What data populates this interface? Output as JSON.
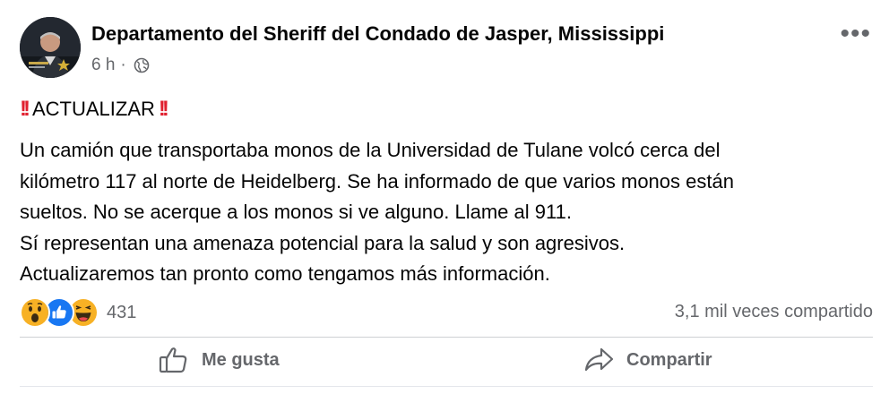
{
  "post": {
    "author": "Departamento del Sheriff del Condado de Jasper, Mississippi",
    "time": "6 h",
    "separator": "·",
    "more_label": "•••",
    "headline": "ACTUALIZAR",
    "body_lines": [
      "Un camión que transportaba monos de la Universidad de Tulane volcó cerca del",
      "kilómetro 117 al norte de Heidelberg. Se ha informado de que varios monos están",
      "sueltos. No se acerque a los monos si ve alguno. Llame al 911.",
      "Sí representan una amenaza potencial para la salud y son agresivos.",
      "Actualizaremos tan pronto como tengamos más información."
    ]
  },
  "stats": {
    "reaction_icons": [
      "wow-reaction-icon",
      "like-reaction-icon",
      "haha-reaction-icon"
    ],
    "reaction_count": "431",
    "shares": "3,1 mil veces compartido"
  },
  "actions": {
    "like_label": "Me gusta",
    "share_label": "Compartir"
  },
  "colors": {
    "text": "#050505",
    "secondary": "#65676b",
    "like_blue": "#1877f2",
    "emoji_yellow": "#f7b125",
    "alert_red": "#e0202f"
  }
}
